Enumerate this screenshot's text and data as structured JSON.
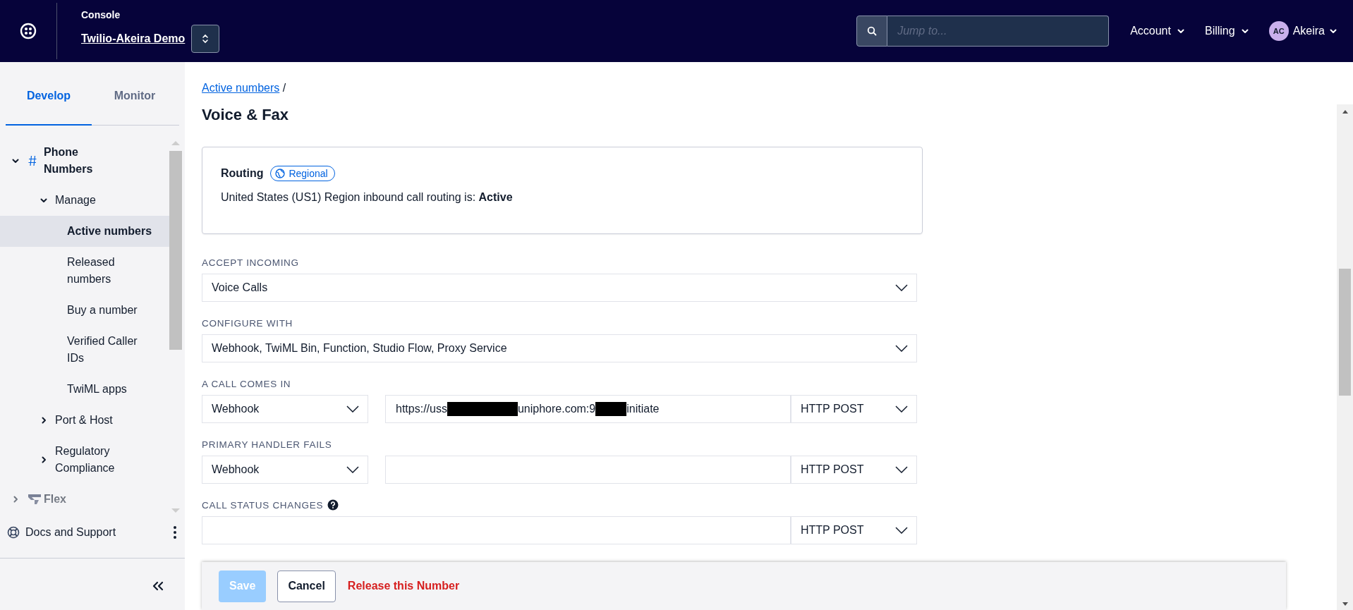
{
  "topbar": {
    "title": "Console",
    "project": "Twilio-Akeira Demo",
    "search": {
      "placeholder": "Jump to..."
    },
    "menus": [
      {
        "label": "Account"
      },
      {
        "label": "Billing"
      }
    ],
    "user": {
      "initials": "AC",
      "name": "Akeira"
    }
  },
  "sidebar": {
    "tabs": [
      {
        "label": "Develop",
        "selected": true
      },
      {
        "label": "Monitor",
        "selected": false
      }
    ],
    "tree": [
      {
        "label": "Phone Numbers",
        "expanded": true,
        "selected": false,
        "children": [
          {
            "label": "Manage",
            "expanded": true,
            "selected": false,
            "children": [
              {
                "label": "Active numbers",
                "selected": true
              },
              {
                "label": "Released numbers",
                "selected": false
              },
              {
                "label": "Buy a number",
                "selected": false
              },
              {
                "label": "Verified Caller IDs",
                "selected": false
              },
              {
                "label": "TwiML apps",
                "selected": false
              }
            ]
          },
          {
            "label": "Port & Host",
            "expanded": false,
            "selected": false
          },
          {
            "label": "Regulatory Compliance",
            "expanded": false,
            "selected": false
          }
        ]
      },
      {
        "label": "Flex",
        "expanded": false,
        "selected": false
      }
    ],
    "footer": {
      "label": "Docs and Support"
    }
  },
  "breadcrumb": {
    "link": "Active numbers",
    "separator": "/"
  },
  "title": "Voice & Fax",
  "routing": {
    "title": "Routing",
    "badge": "Regional",
    "text": "United States (US1) Region inbound call routing is: **Active**"
  },
  "fields": [
    {
      "label": "ACCEPT INCOMING",
      "help": false,
      "controls": [
        {
          "kind": "select",
          "value": "Voice Calls"
        }
      ]
    },
    {
      "label": "CONFIGURE WITH",
      "help": false,
      "controls": [
        {
          "kind": "select",
          "value": "Webhook, TwiML Bin, Function, Studio Flow, Proxy Service"
        }
      ]
    },
    {
      "label": "A CALL COMES IN",
      "help": false,
      "controls": [
        {
          "kind": "select",
          "value": "Webhook"
        },
        {
          "kind": "url",
          "parts": [
            {
              "kind": "text",
              "text": "https://uss"
            },
            {
              "kind": "redaction"
            },
            {
              "kind": "text",
              "text": "uniphore.com:9"
            },
            {
              "kind": "redaction"
            },
            {
              "kind": "text",
              "text": "initiate"
            }
          ]
        },
        {
          "kind": "method",
          "value": "HTTP POST"
        }
      ]
    },
    {
      "label": "PRIMARY HANDLER FAILS",
      "help": false,
      "controls": [
        {
          "kind": "select",
          "value": "Webhook"
        },
        {
          "kind": "url"
        },
        {
          "kind": "method",
          "value": "HTTP POST"
        }
      ]
    },
    {
      "label": "CALL STATUS CHANGES",
      "help": true,
      "controls": [
        {
          "kind": "url"
        },
        {
          "kind": "method",
          "value": "HTTP POST"
        }
      ]
    }
  ],
  "actions": [
    {
      "label": "Save",
      "kind": "primary",
      "disabled": true
    },
    {
      "label": "Cancel",
      "kind": "secondary",
      "disabled": false
    },
    {
      "label": "Release this Number",
      "kind": "danger",
      "disabled": false
    }
  ]
}
